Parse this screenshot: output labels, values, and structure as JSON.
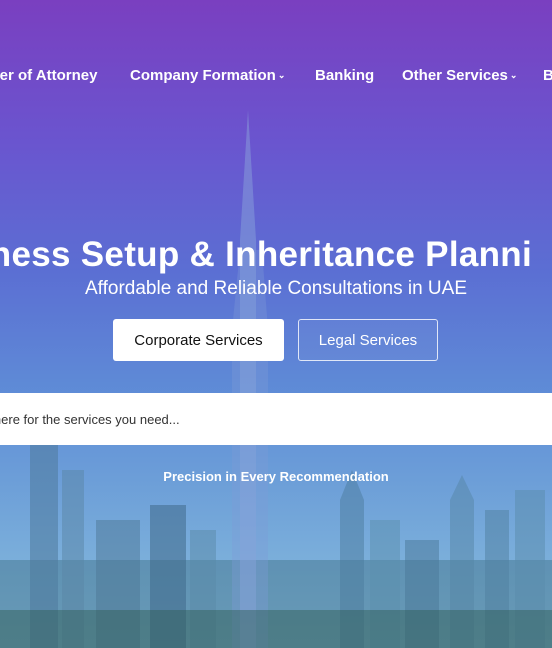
{
  "nav": {
    "items": [
      {
        "label": "wer of Attorney"
      },
      {
        "label": "Company Formation",
        "chevron": "chevron-down-icon"
      },
      {
        "label": "Banking"
      },
      {
        "label": "Other Services",
        "chevron": "chevron-down-icon"
      },
      {
        "label": "B"
      }
    ]
  },
  "hero": {
    "title": "siness Setup & Inheritance Planni",
    "subtitle": "Affordable and Reliable Consultations in UAE",
    "buttons": {
      "corporate": "Corporate Services",
      "legal": "Legal Services"
    }
  },
  "search": {
    "placeholder": "arch here for the services you need..."
  },
  "tagline": "Precision in Every Recommendation",
  "colors": {
    "gradient_top": "#7a3fc0",
    "gradient_mid": "#5b6fd3",
    "gradient_bottom": "#8bc0de",
    "button_bg": "#ffffff"
  }
}
